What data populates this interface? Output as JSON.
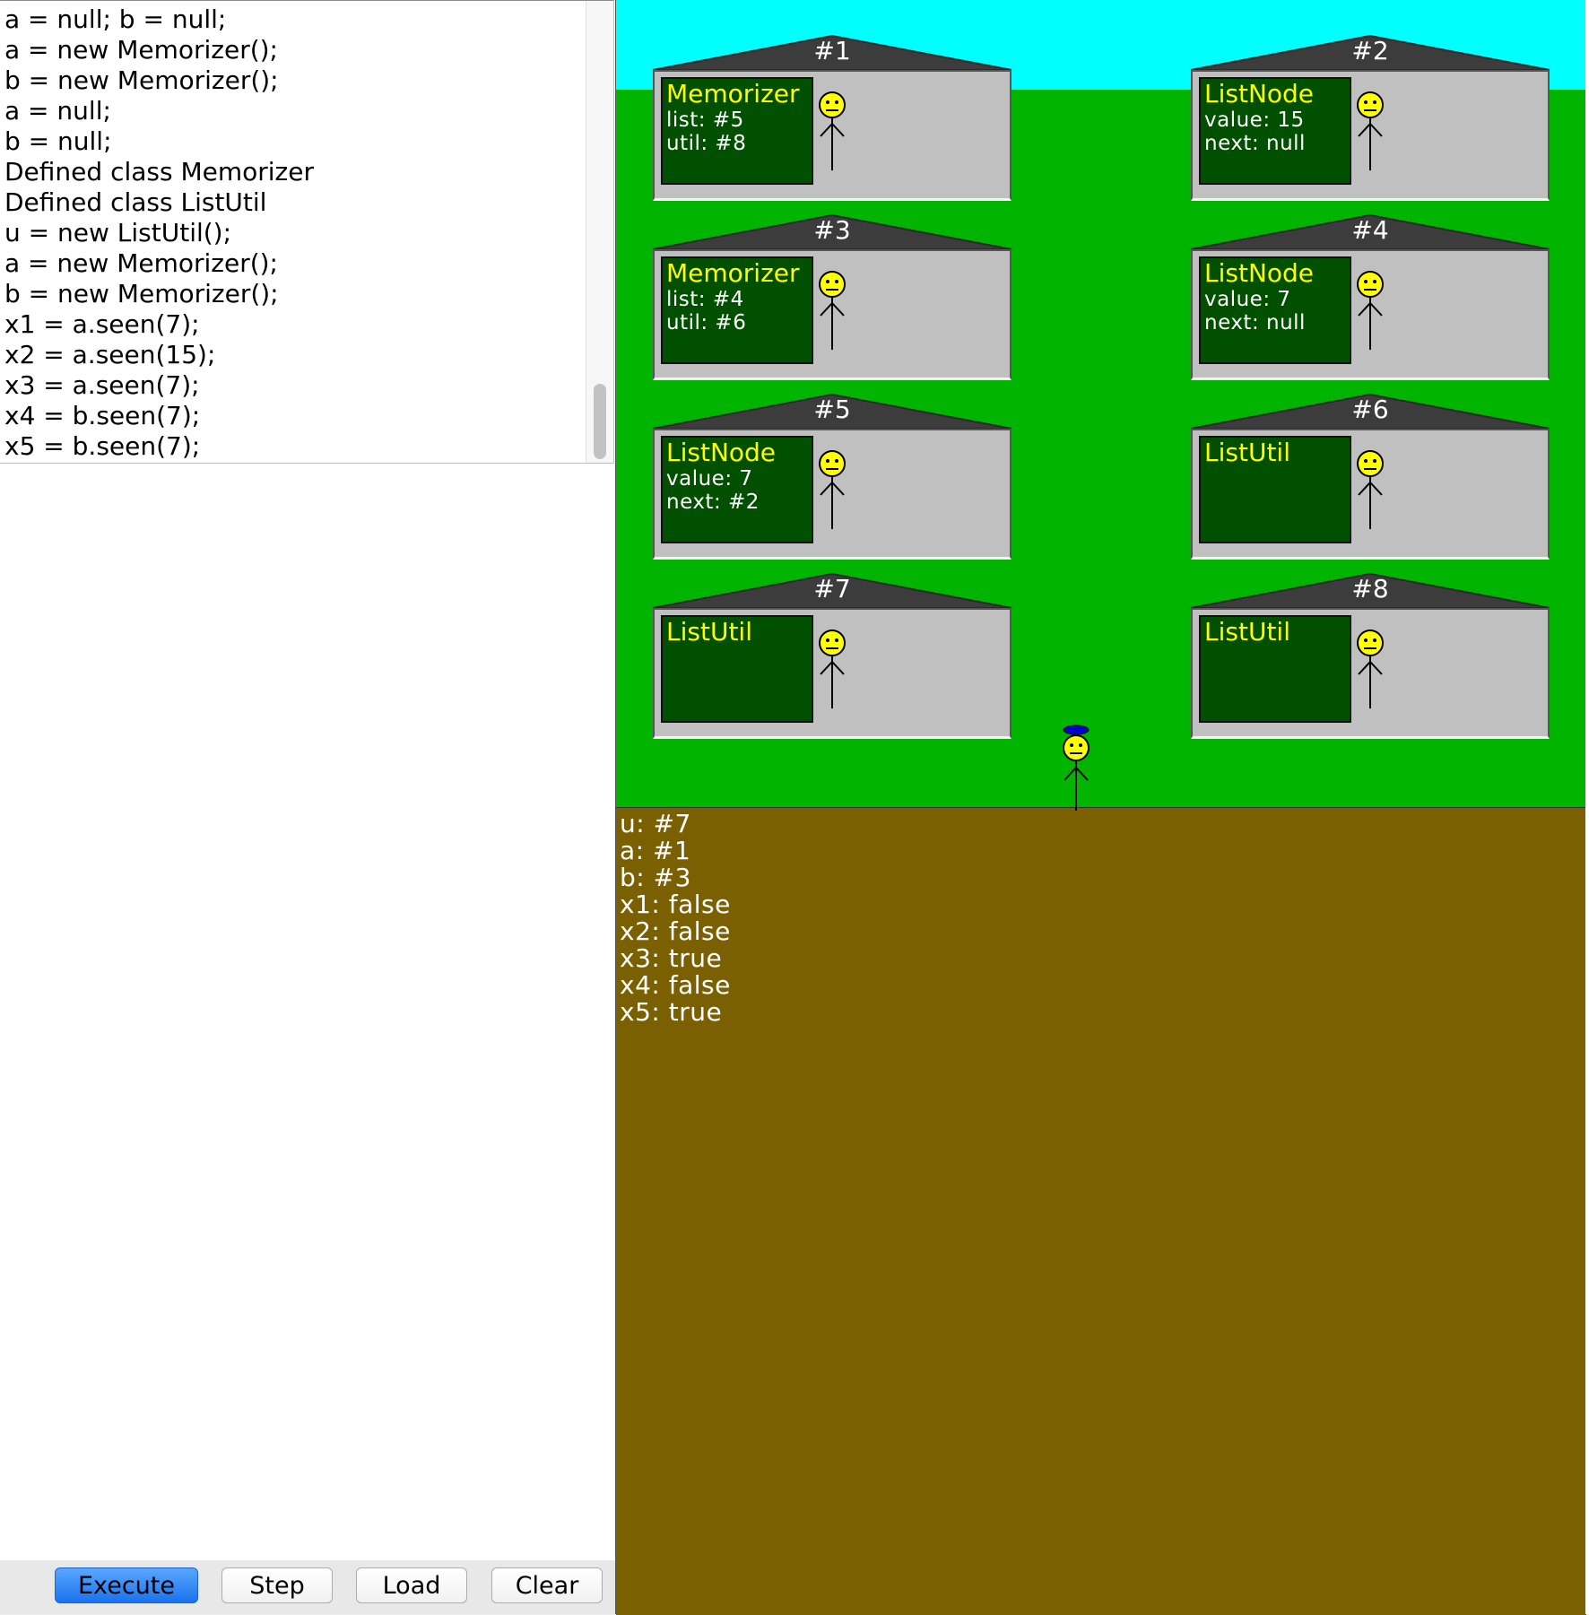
{
  "history": {
    "lines": [
      "a = null; b = null;",
      "a = new Memorizer();",
      "b = new Memorizer();",
      "a = null;",
      "b = null;",
      "Defined class Memorizer",
      "Defined class ListUtil",
      "u = new ListUtil();",
      "a = new Memorizer();",
      "b = new Memorizer();",
      "x1 = a.seen(7);",
      "x2 = a.seen(15);",
      "x3 = a.seen(7);",
      "x4 = b.seen(7);",
      "x5 = b.seen(7);"
    ]
  },
  "editor": {
    "value": ""
  },
  "buttons": {
    "execute": "Execute",
    "step": "Step",
    "load": "Load",
    "clear": "Clear"
  },
  "houses": [
    {
      "id": "#1",
      "class": "Memorizer",
      "fields": [
        {
          "text": "list:  #5"
        },
        {
          "text": "util:  #8"
        }
      ]
    },
    {
      "id": "#2",
      "class": "ListNode",
      "fields": [
        {
          "text": "value:  15"
        },
        {
          "text": "next:  null"
        }
      ]
    },
    {
      "id": "#3",
      "class": "Memorizer",
      "fields": [
        {
          "text": "list:  #4"
        },
        {
          "text": "util:  #6"
        }
      ]
    },
    {
      "id": "#4",
      "class": "ListNode",
      "fields": [
        {
          "text": "value:  7"
        },
        {
          "text": "next:  null"
        }
      ]
    },
    {
      "id": "#5",
      "class": "ListNode",
      "fields": [
        {
          "text": "value:  7"
        },
        {
          "text": "next:  #2"
        }
      ]
    },
    {
      "id": "#6",
      "class": "ListUtil",
      "fields": []
    },
    {
      "id": "#7",
      "class": "ListUtil",
      "fields": []
    },
    {
      "id": "#8",
      "class": "ListUtil",
      "fields": []
    }
  ],
  "variables": [
    "u:  #7",
    "a:  #1",
    "b:  #3",
    "x1:  false",
    "x2:  false",
    "x3:  true",
    "x4:  false",
    "x5:  true"
  ],
  "icons": {
    "house_occupant": "stick-figure-icon",
    "agent": "stick-figure-with-cap-icon"
  },
  "colors": {
    "sky": "#00ffff",
    "grass": "#00b400",
    "dirt": "#7a6000",
    "wall": "#c0c0c0",
    "roof": "#3c3c3c",
    "board": "#005000",
    "class_name": "#ffff00",
    "face": "#ffff00",
    "cap": "#0000cc",
    "execute_button": "#1a72ee"
  }
}
